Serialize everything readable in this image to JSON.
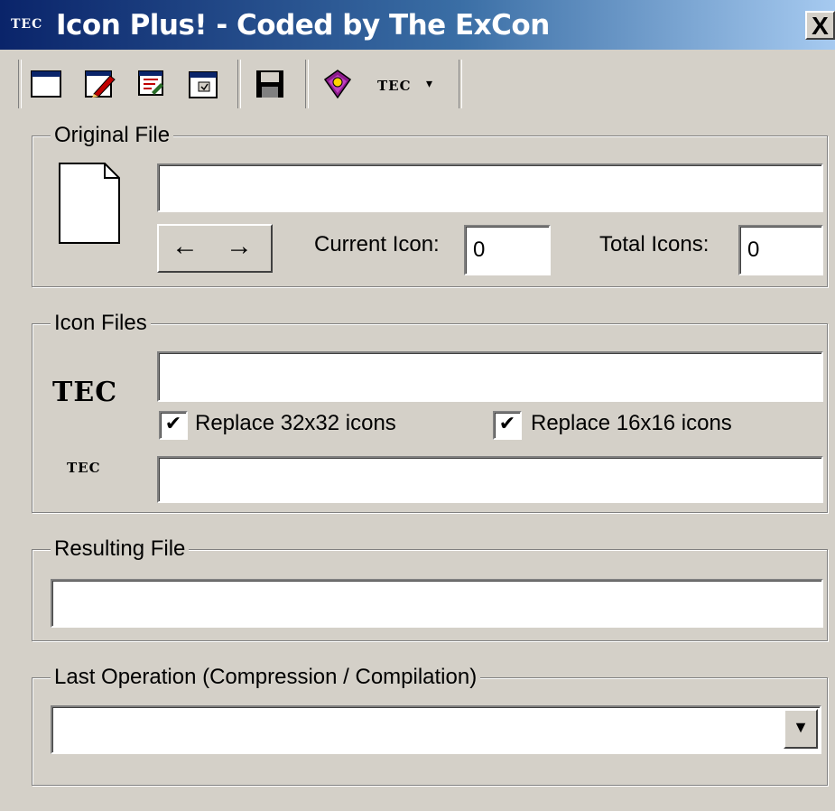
{
  "window": {
    "title": "Icon Plus! - Coded by The ExCon",
    "title_icon_text": "TEC",
    "close_label": "X"
  },
  "toolbar": {
    "buttons": [
      {
        "icon": "window-icon"
      },
      {
        "icon": "edit-icon"
      },
      {
        "icon": "compile-icon"
      },
      {
        "icon": "settings-window-icon"
      },
      {
        "icon": "save-icon"
      },
      {
        "icon": "help-book-icon"
      }
    ],
    "tec_label": "TEC",
    "dropdown_arrow": "▾"
  },
  "original_file": {
    "legend": "Original File",
    "path_value": "",
    "prev_arrow": "←",
    "next_arrow": "→",
    "current_icon_label": "Current Icon:",
    "current_icon_value": "0",
    "total_icons_label": "Total Icons:",
    "total_icons_value": "0"
  },
  "icon_files": {
    "legend": "Icon Files",
    "large_icon_text": "TEC",
    "small_icon_text": "TEC",
    "large_path_value": "",
    "small_path_value": "",
    "replace_32_label": "Replace 32x32 icons",
    "replace_32_checked": true,
    "replace_16_label": "Replace 16x16 icons",
    "replace_16_checked": true,
    "check_mark": "✔"
  },
  "resulting_file": {
    "legend": "Resulting File",
    "path_value": ""
  },
  "last_operation": {
    "legend": "Last Operation (Compression / Compilation)",
    "selected_value": "",
    "dropdown_arrow": "▼"
  }
}
